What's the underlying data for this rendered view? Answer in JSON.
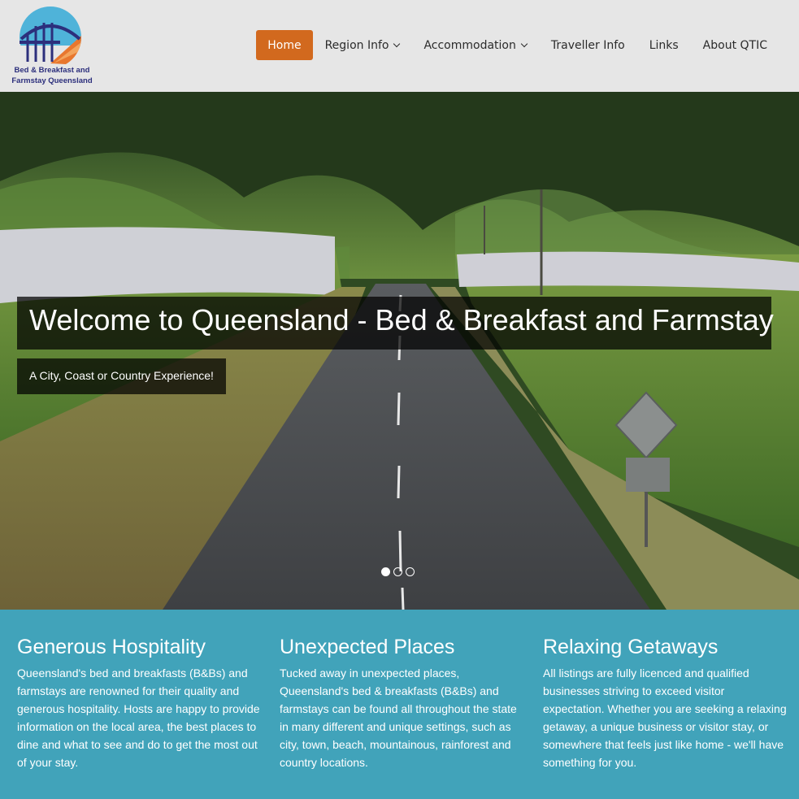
{
  "brand": {
    "logo_text_line1": "Bed & Breakfast and",
    "logo_text_line2": "Farmstay Queensland"
  },
  "nav": {
    "items": [
      {
        "label": "Home",
        "active": true,
        "dropdown": false
      },
      {
        "label": "Region Info",
        "active": false,
        "dropdown": true
      },
      {
        "label": "Accommodation",
        "active": false,
        "dropdown": true
      },
      {
        "label": "Traveller Info",
        "active": false,
        "dropdown": false
      },
      {
        "label": "Links",
        "active": false,
        "dropdown": false
      },
      {
        "label": "About QTIC",
        "active": false,
        "dropdown": false
      }
    ]
  },
  "hero": {
    "title": "Welcome to Queensland - Bed & Breakfast and Farmstay",
    "subtitle": "A City, Coast or Country Experience!",
    "slide_count": 3,
    "active_slide": 1
  },
  "features": [
    {
      "heading": "Generous Hospitality",
      "text": "Queensland's bed and breakfasts (B&Bs) and farmstays are renowned for their quality and generous hospitality. Hosts are happy to provide information on the local area, the best places to dine and what to see and do to get the most out of your stay."
    },
    {
      "heading": "Unexpected Places",
      "text": "Tucked away in unexpected places, Queensland's bed & breakfasts (B&Bs) and farmstays can be found all throughout the state in many different and unique settings, such as city, town, beach, mountainous, rainforest and country locations."
    },
    {
      "heading": "Relaxing Getaways",
      "text": "All listings are fully licenced and qualified businesses striving to exceed visitor expectation. Whether you are seeking a relaxing getaway, a unique business or visitor stay, or somewhere that feels just like home - we'll have something for you."
    }
  ],
  "colors": {
    "accent": "#d2691e",
    "feature_bg": "#41a3ba",
    "header_bg": "#e6e6e6",
    "brand_text": "#2c2f7c"
  }
}
